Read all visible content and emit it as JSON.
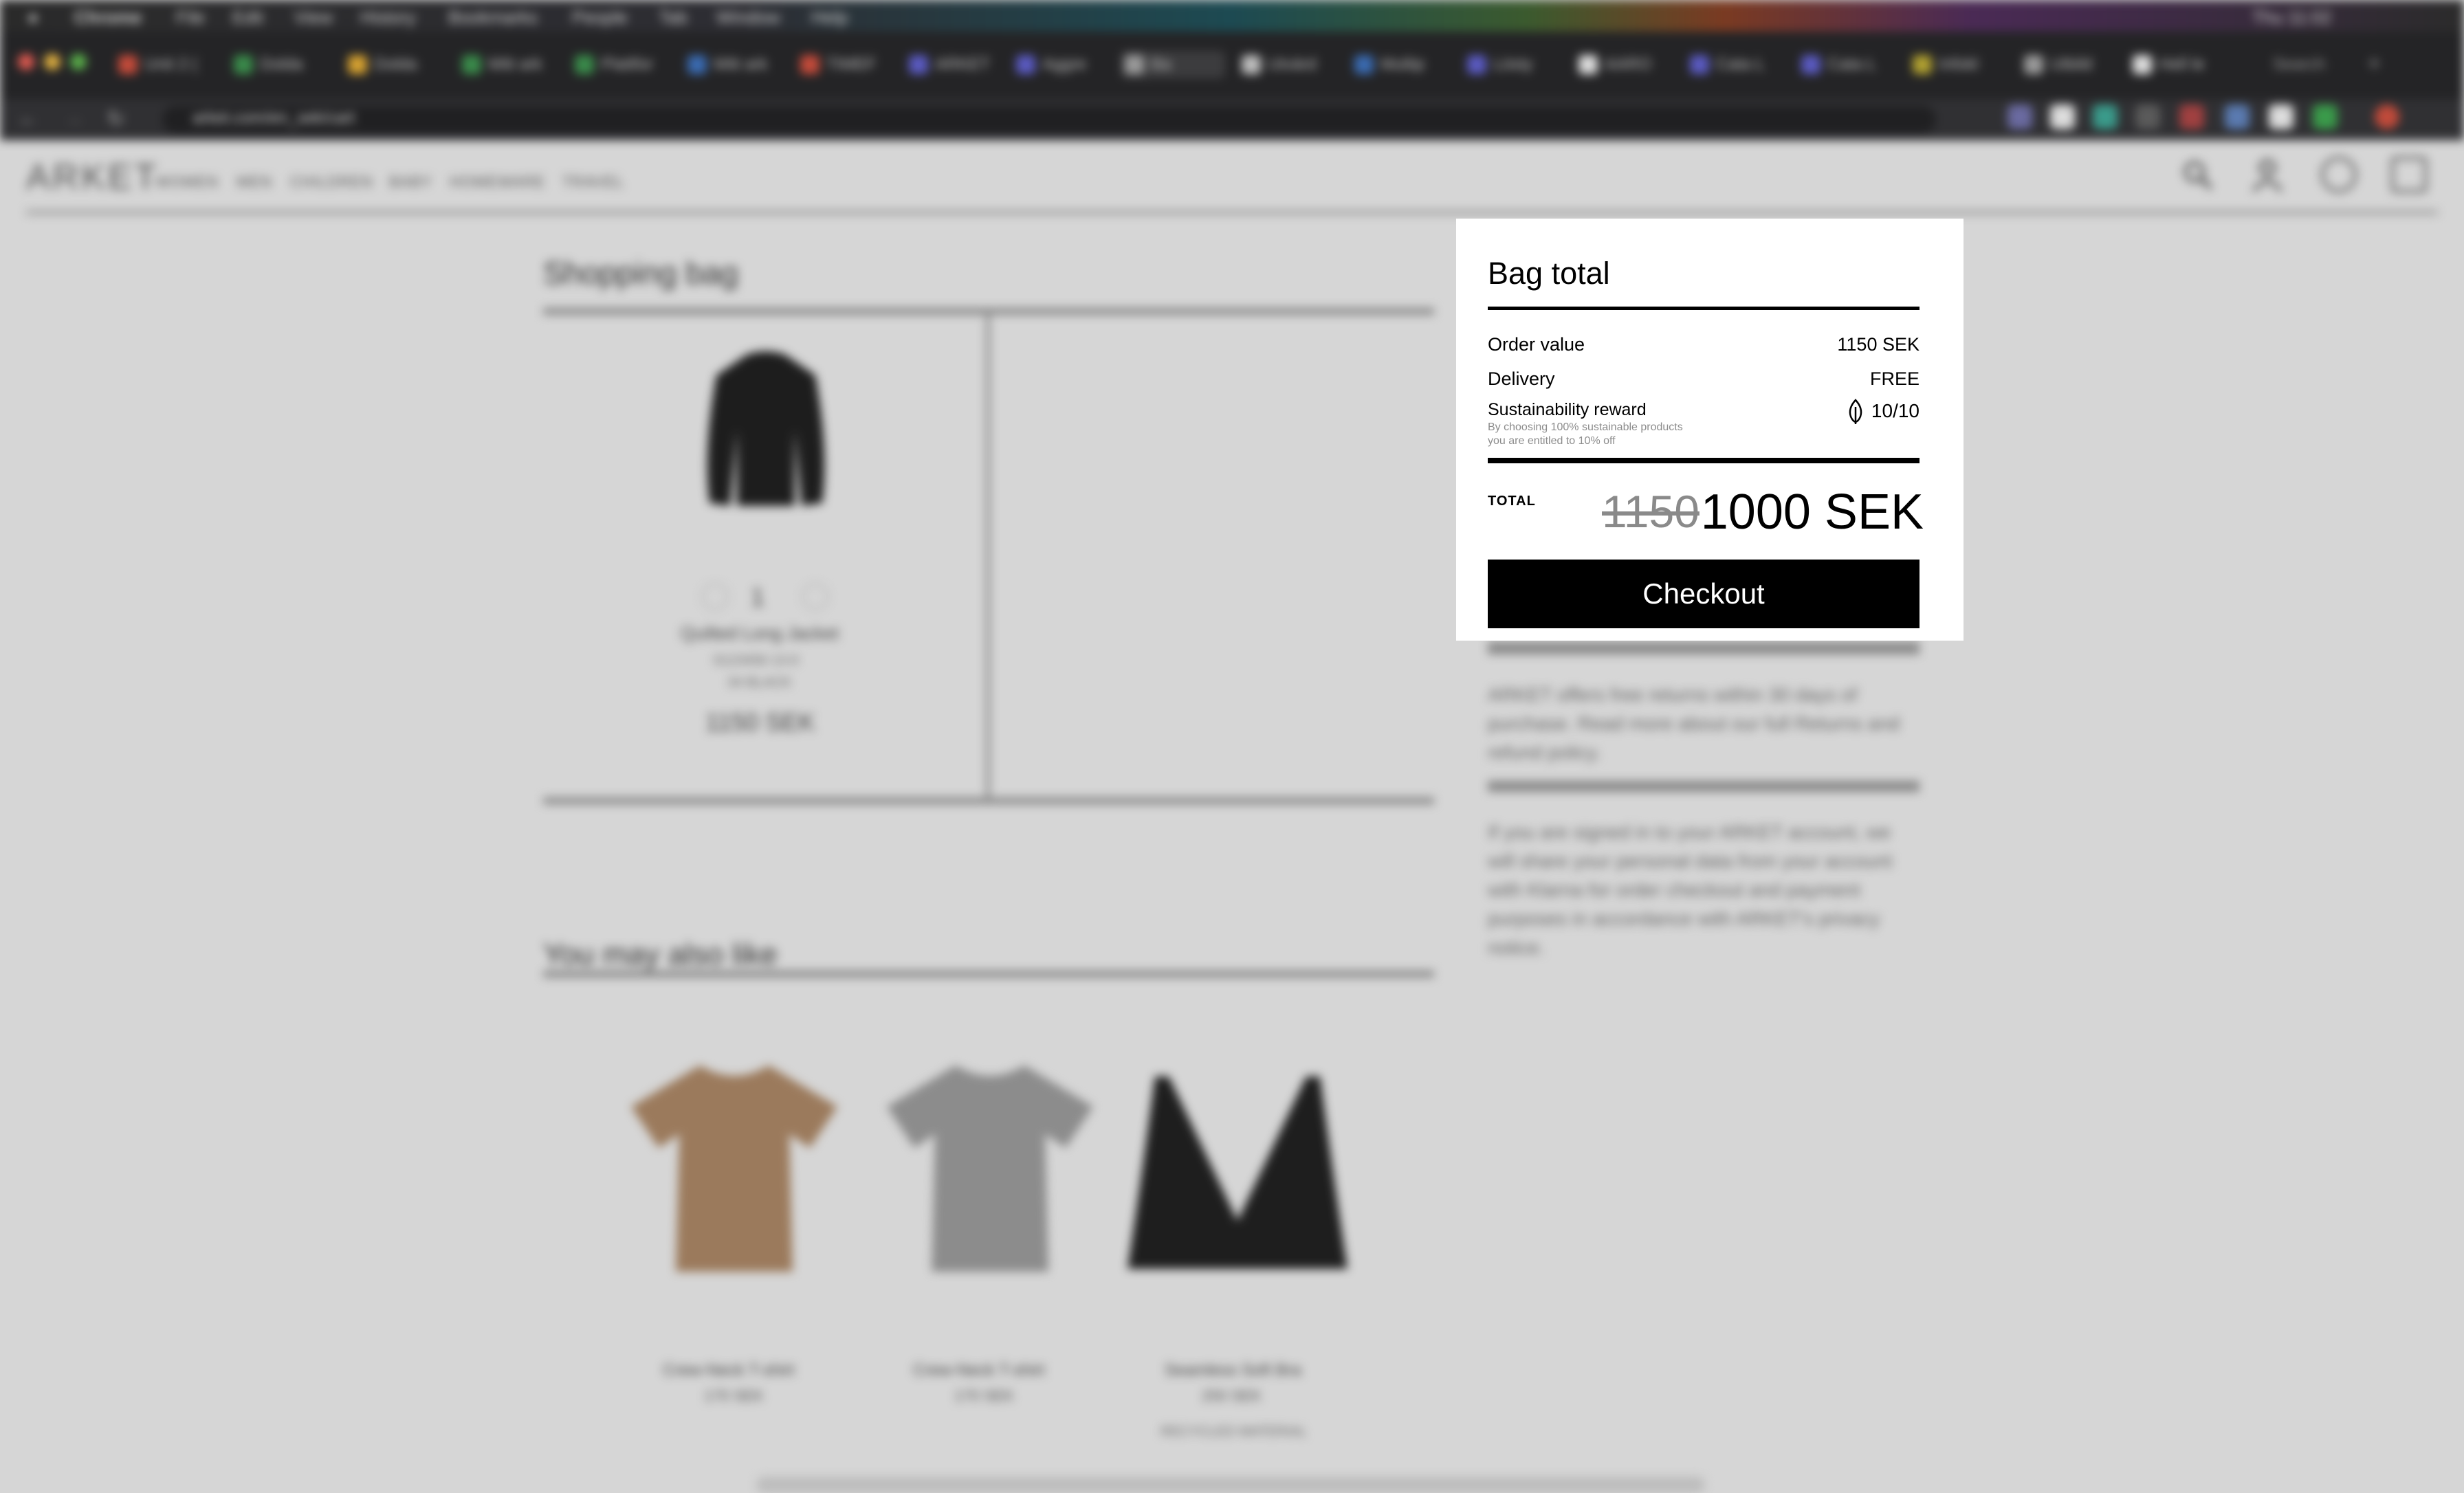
{
  "browser": {
    "menu": [
      "Chrome",
      "File",
      "Edit",
      "View",
      "History",
      "Bookmarks",
      "People",
      "Tab",
      "Window",
      "Help"
    ],
    "clock": "Thu 11:02",
    "tabs": [
      "Unit 2 (",
      "Dolda",
      "Dolda",
      "Mitt ark",
      "Plattfor",
      "Mitt ark",
      "TIMEF",
      "ARKET",
      "Aggre",
      "Ba",
      "Utvärd",
      "Multip",
      "Lösty",
      "AARO",
      "Cata L",
      "Cata L",
      "Infokl",
      "Utbild",
      "Hell le"
    ],
    "new_tab_label": "Search",
    "url": "arket.com/en_sek/cart"
  },
  "site": {
    "logo": "ARKET",
    "nav": [
      "WOMEN",
      "MEN",
      "CHILDREN",
      "BABY",
      "HOMEWARE",
      "TRAVEL"
    ]
  },
  "bag": {
    "title": "Shopping bag",
    "item": {
      "qty": "1",
      "name": "Quilted Long Jacket",
      "meta1": "0123456 13-0",
      "meta2": "34 BLACK",
      "price": "1150 SEK"
    }
  },
  "panel": {
    "title": "Bag total",
    "order_value_label": "Order value",
    "order_value": "1150 SEK",
    "delivery_label": "Delivery",
    "delivery": "FREE",
    "sustainability_label": "Sustainability reward",
    "sustainability_note_1": "By choosing 100% sustainable products",
    "sustainability_note_2": "you are entitled to 10% off",
    "sustainability_score": "10/10",
    "total_label": "TOTAL",
    "old_total": "1150",
    "new_total": "1000 SEK",
    "checkout_label": "Checkout"
  },
  "info": {
    "returns": "ARKET offers free returns within 30 days of purchase. Read more about our full Returns and refund policy.",
    "privacy": "If you are signed in to your ARKET account, we will share your personal data from your account with Klarna for order checkout and payment purposes in accordance with ARKET's privacy notice."
  },
  "also": {
    "title": "You may also like",
    "products": [
      {
        "name": "Crew-Neck T-shirt",
        "price": "170 SEK",
        "color": "#9b7a5c"
      },
      {
        "name": "Crew-Neck T-shirt",
        "price": "170 SEK",
        "color": "#8c8c8c"
      },
      {
        "name": "Seamless Soft Bra",
        "price": "250 SEK",
        "badge": "RECYCLED MATERIAL",
        "color": "#1e1e1e"
      }
    ]
  }
}
